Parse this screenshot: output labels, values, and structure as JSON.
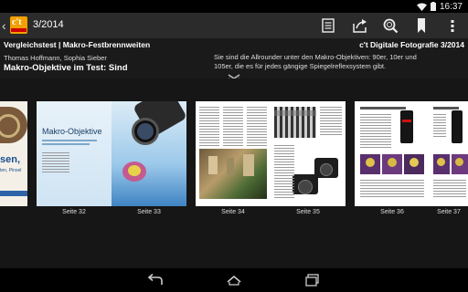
{
  "status": {
    "time": "16:37"
  },
  "actionbar": {
    "issue": "3/2014",
    "logo_text": "c't",
    "icons": [
      "toc-icon",
      "share-icon",
      "search-icon",
      "bookmark-icon",
      "overflow-menu-icon"
    ]
  },
  "article": {
    "kicker": "Vergleichstest | Makro-Festbrennweiten",
    "magazine": "c't Digitale Fotografie 3/2014",
    "authors": "Thomas Hoffmann, Sophia Sieber",
    "headline": "Makro-Objektive im Test: Sind",
    "teaser": "Sie sind die Allrounder unter den Makro-Objektiven: 90er, 10er und 105er, die es für jedes gängige Spiegelreflexsystem gibt."
  },
  "pages": {
    "prev_cover_text": "sen,",
    "prev_cover_text2": "ten, Pinsel",
    "spread1_title": "Makro-Objektive",
    "labels": [
      "Seite 32",
      "Seite 33",
      "Seite 34",
      "Seite 35",
      "Seite 36",
      "Seite 37"
    ]
  },
  "colors": {
    "actionbar": "#2b2b2b",
    "header": "#1a1a1a",
    "strip": "#161616",
    "accent": "#f2a000"
  }
}
